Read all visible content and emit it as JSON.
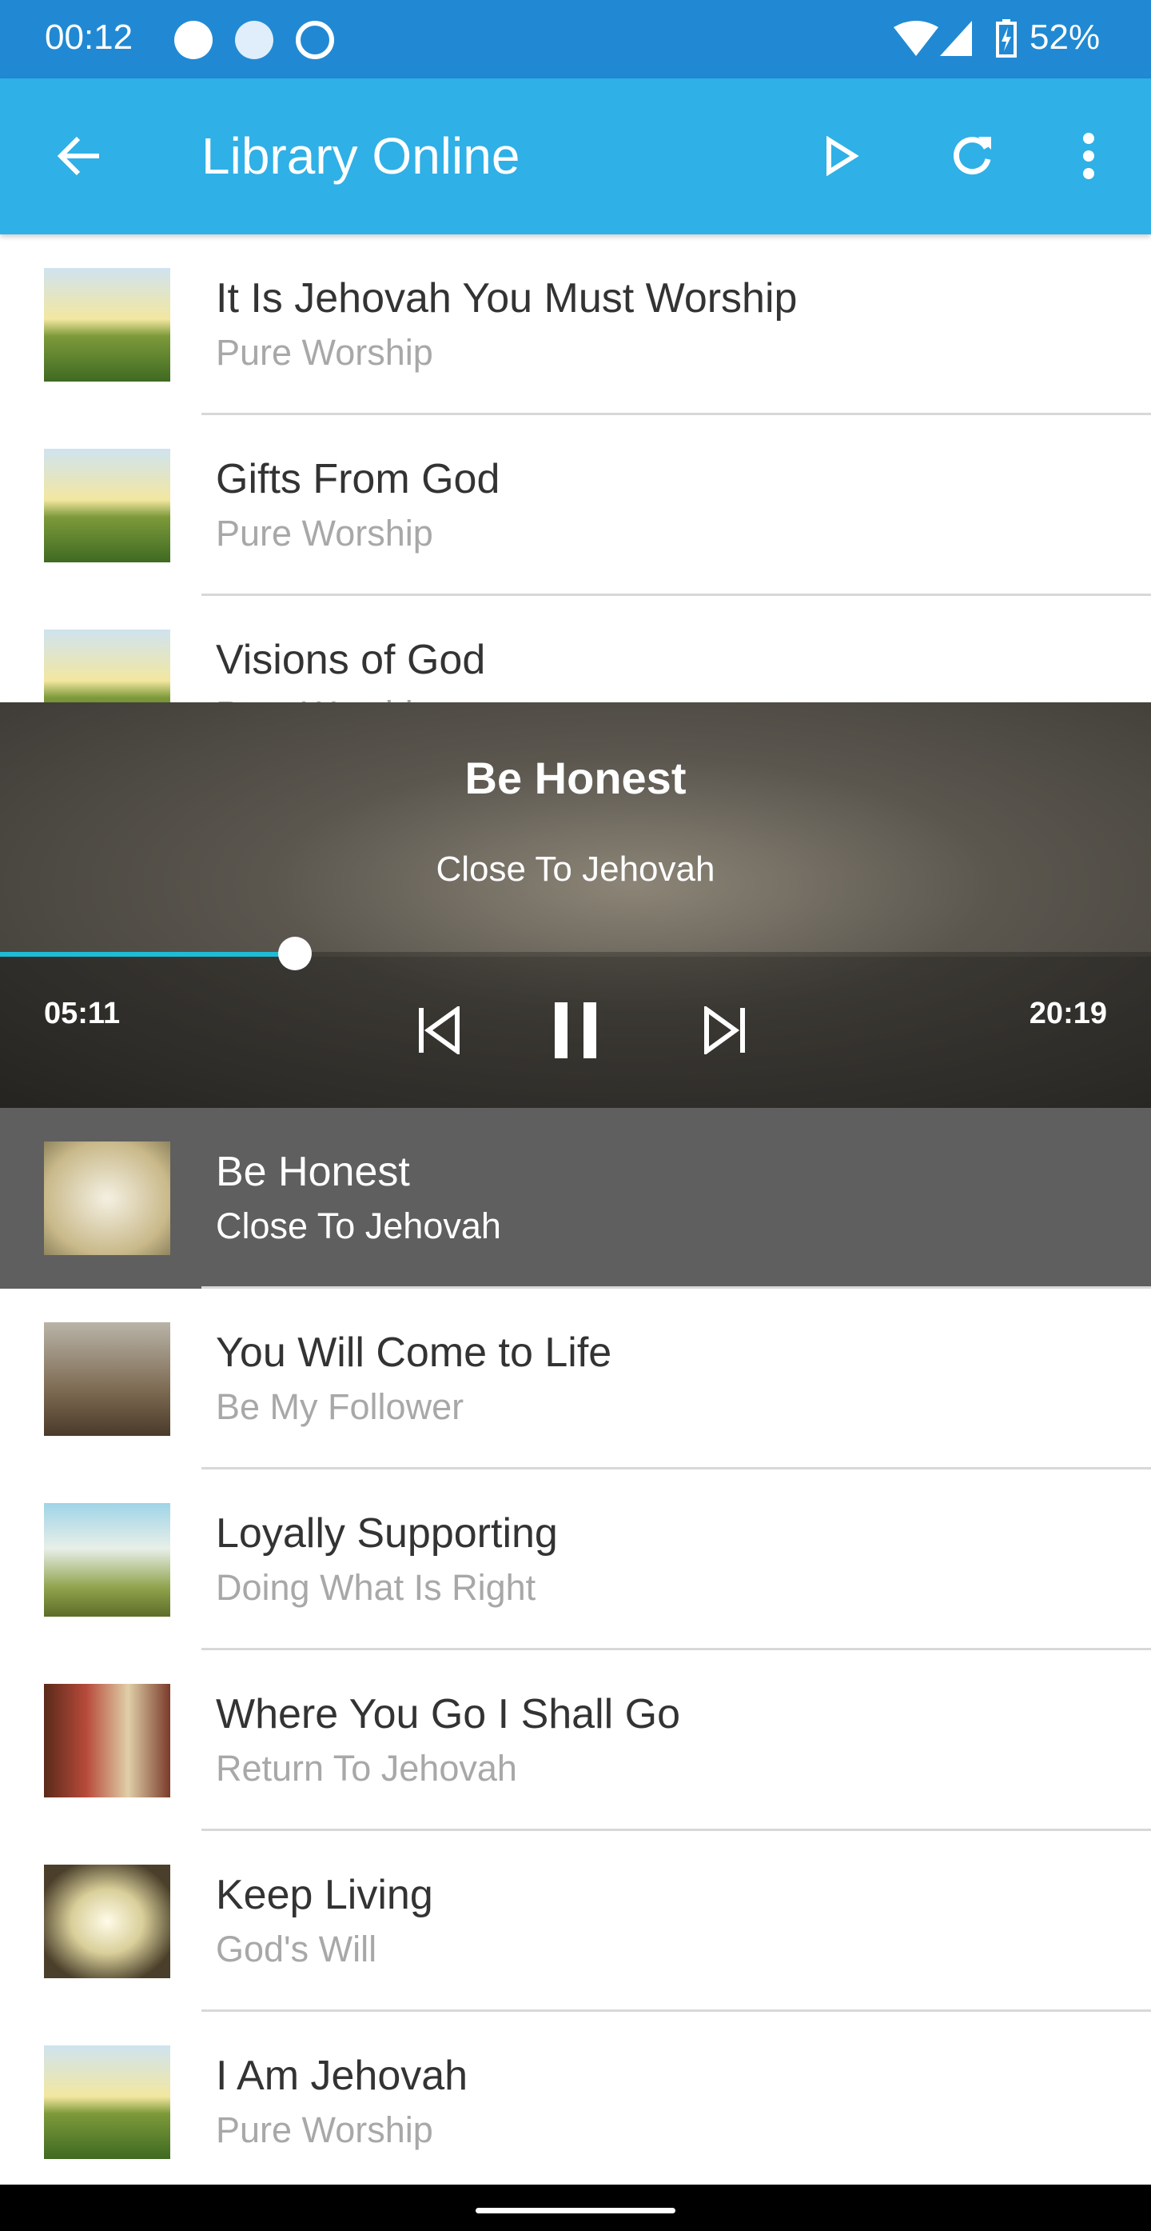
{
  "status_bar": {
    "time": "00:12",
    "battery": "52%",
    "icons": [
      "play-circle-icon",
      "notification-n-icon",
      "at-sign-icon",
      "wifi-icon",
      "signal-icon",
      "battery-charging-icon"
    ]
  },
  "app_bar": {
    "title": "Library Online",
    "icons": [
      "back-arrow-icon",
      "play-icon",
      "refresh-icon",
      "more-vert-icon"
    ]
  },
  "list": [
    {
      "title": "It Is Jehovah You Must Worship",
      "subtitle": "Pure Worship"
    },
    {
      "title": "Gifts From God",
      "subtitle": "Pure Worship"
    },
    {
      "title": "Visions of God",
      "subtitle": "Pure Worship"
    },
    {
      "title": "Be Honest",
      "subtitle": "Close To Jehovah",
      "active": true
    },
    {
      "title": "You Will Come to Life",
      "subtitle": "Be My Follower"
    },
    {
      "title": "Loyally Supporting",
      "subtitle": "Doing What Is Right"
    },
    {
      "title": "Where You Go I Shall Go",
      "subtitle": "Return To Jehovah"
    },
    {
      "title": "Keep Living",
      "subtitle": "God's Will"
    },
    {
      "title": "I Am Jehovah",
      "subtitle": "Pure Worship"
    }
  ],
  "player": {
    "title": "Be Honest",
    "subtitle": "Close To Jehovah",
    "elapsed": "05:11",
    "duration": "20:19",
    "progress_percent": 25.6,
    "accent": "#1ebcd6",
    "state": "playing"
  },
  "colors": {
    "status_bar": "#2189d3",
    "app_bar": "#2fb0e6",
    "active_row": "#5f5f5f"
  }
}
